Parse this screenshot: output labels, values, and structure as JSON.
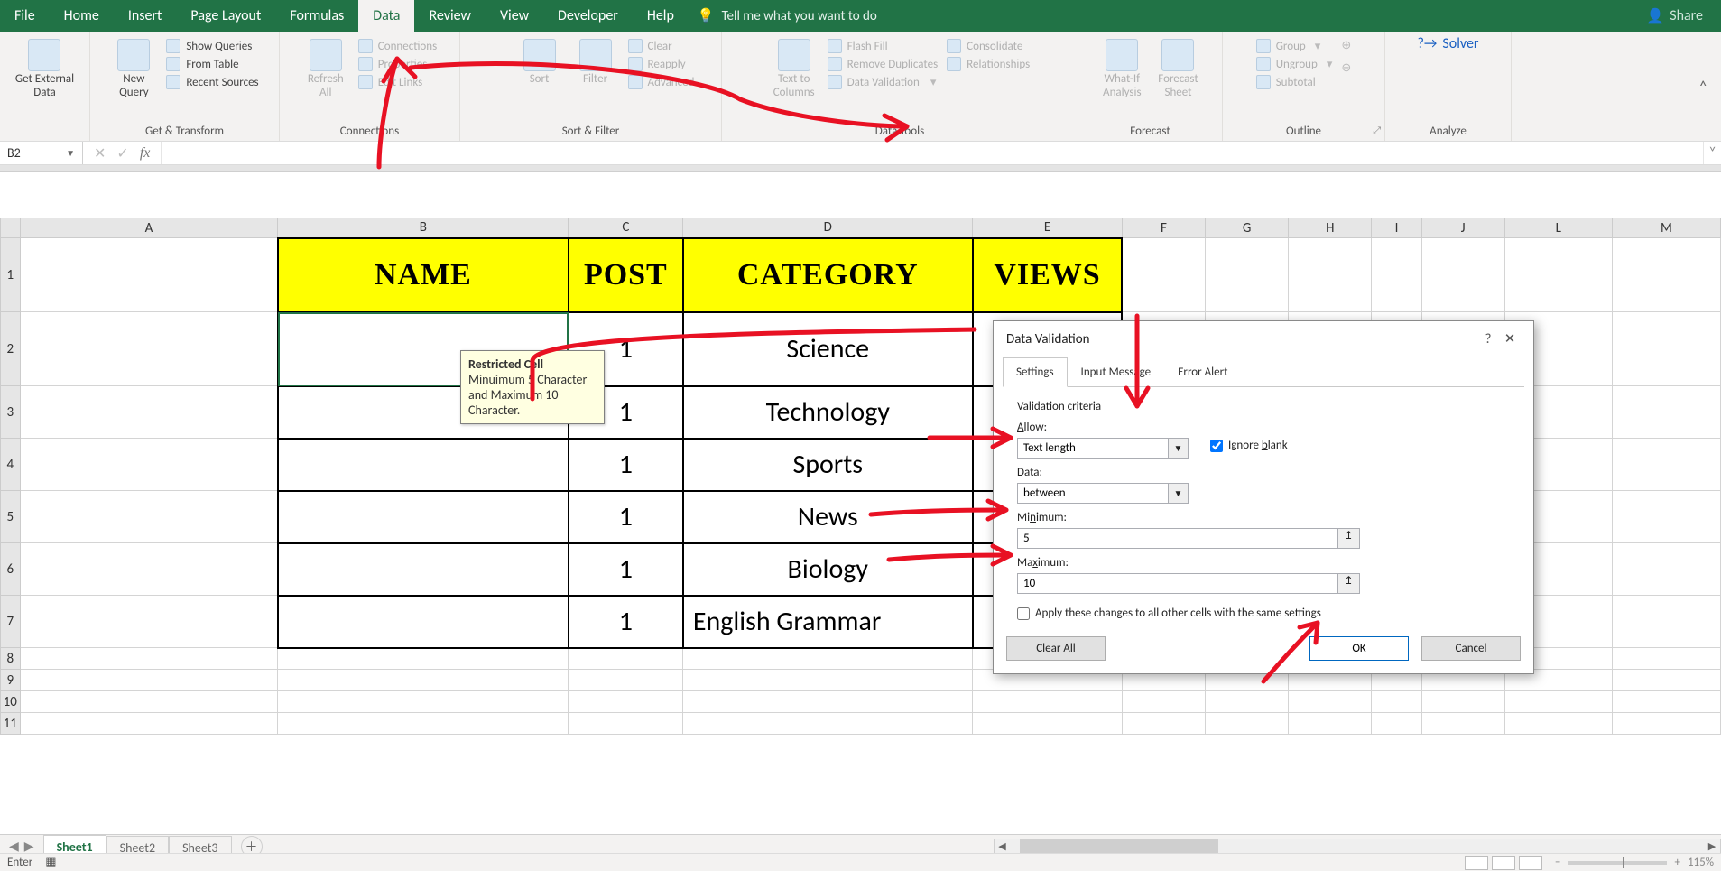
{
  "tabs": {
    "file": "File",
    "home": "Home",
    "insert": "Insert",
    "page_layout": "Page Layout",
    "formulas": "Formulas",
    "data": "Data",
    "review": "Review",
    "view": "View",
    "developer": "Developer",
    "help": "Help",
    "tell_me": "Tell me what you want to do",
    "share": "Share"
  },
  "ribbon": {
    "get_external": "Get External\nData",
    "new_query": "New\nQuery",
    "show_queries": "Show Queries",
    "from_table": "From Table",
    "recent_sources": "Recent Sources",
    "group_get_transform": "Get & Transform",
    "refresh_all": "Refresh\nAll",
    "connections": "Connections",
    "properties": "Properties",
    "edit_links": "Edit Links",
    "group_connections": "Connections",
    "sort": "Sort",
    "filter": "Filter",
    "clear": "Clear",
    "reapply": "Reapply",
    "advanced": "Advanced",
    "group_sort_filter": "Sort & Filter",
    "text_to_columns": "Text to\nColumns",
    "flash_fill": "Flash Fill",
    "remove_duplicates": "Remove Duplicates",
    "data_validation": "Data Validation",
    "consolidate": "Consolidate",
    "relationships": "Relationships",
    "group_data_tools": "Data Tools",
    "what_if": "What-If\nAnalysis",
    "forecast_sheet": "Forecast\nSheet",
    "group_forecast": "Forecast",
    "group_btn": "Group",
    "ungroup": "Ungroup",
    "subtotal": "Subtotal",
    "group_outline": "Outline",
    "solver": "Solver",
    "group_analyze": "Analyze"
  },
  "namebox": "B2",
  "columns": [
    "A",
    "B",
    "C",
    "D",
    "E",
    "F",
    "G",
    "H",
    "I",
    "J",
    "L",
    "M"
  ],
  "rows": [
    "1",
    "2",
    "3",
    "4",
    "5",
    "6",
    "7",
    "8",
    "9",
    "10",
    "11"
  ],
  "headers": {
    "b": "NAME",
    "c": "POST",
    "d": "CATEGORY",
    "e": "VIEWS"
  },
  "datarows": [
    {
      "c": "1",
      "d": "Science"
    },
    {
      "c": "1",
      "d": "Technology"
    },
    {
      "c": "1",
      "d": "Sports"
    },
    {
      "c": "1",
      "d": "News"
    },
    {
      "c": "1",
      "d": "Biology"
    },
    {
      "c": "1",
      "d": "English Grammar"
    }
  ],
  "tooltip": {
    "title": "Restricted Cell",
    "body": "Minuimum 5 Character and Maximum 10 Character."
  },
  "dialog": {
    "title": "Data Validation",
    "tab_settings": "Settings",
    "tab_input_message": "Input Message",
    "tab_error_alert": "Error Alert",
    "criteria_label": "Validation criteria",
    "allow_label": "Allow:",
    "allow_value": "Text length",
    "ignore_blank": "Ignore blank",
    "data_label": "Data:",
    "data_value": "between",
    "min_label": "Minimum:",
    "min_value": "5",
    "max_label": "Maximum:",
    "max_value": "10",
    "apply_all": "Apply these changes to all other cells with the same settings",
    "clear_all": "Clear All",
    "ok": "OK",
    "cancel": "Cancel"
  },
  "sheets": {
    "s1": "Sheet1",
    "s2": "Sheet2",
    "s3": "Sheet3"
  },
  "status": {
    "mode": "Enter",
    "zoom": "115%"
  }
}
